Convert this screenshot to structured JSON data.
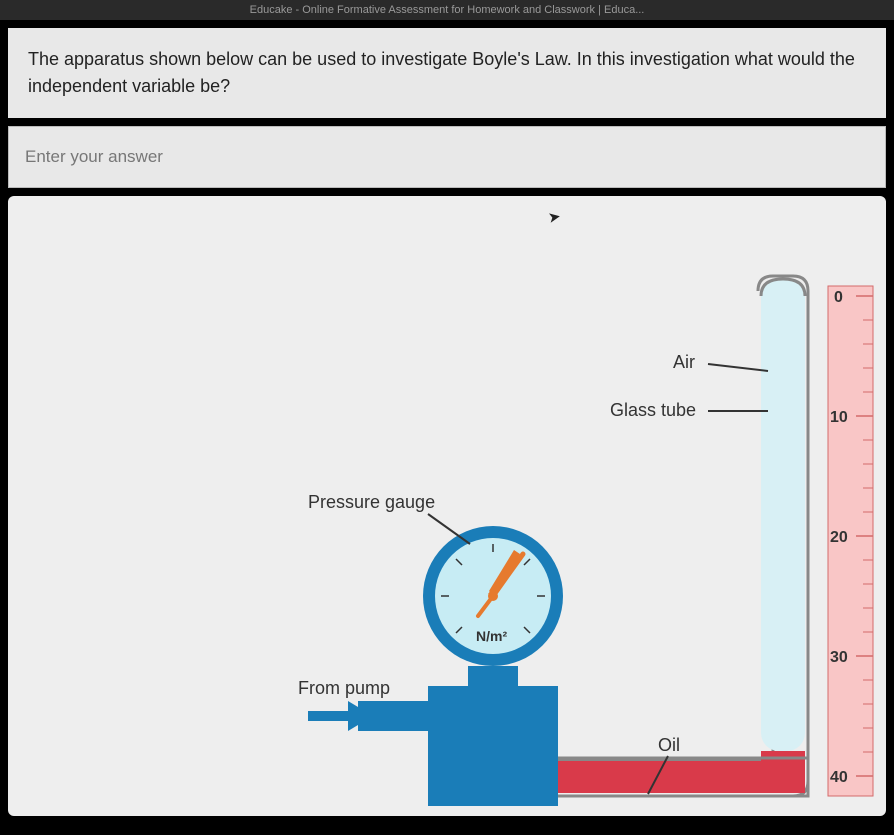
{
  "tab": {
    "title": "Educake - Online Formative Assessment for Homework and Classwork | Educa..."
  },
  "question": {
    "text": "The apparatus shown below can be used to investigate Boyle's Law. In this investigation what would the independent variable be?"
  },
  "answer": {
    "placeholder": "Enter your answer"
  },
  "diagram": {
    "labels": {
      "air": "Air",
      "glass_tube": "Glass tube",
      "pressure_gauge": "Pressure gauge",
      "from_pump": "From pump",
      "oil": "Oil"
    },
    "gauge_unit": "N/m²",
    "ruler": {
      "marks": [
        "0",
        "10",
        "20",
        "30",
        "40"
      ]
    }
  }
}
